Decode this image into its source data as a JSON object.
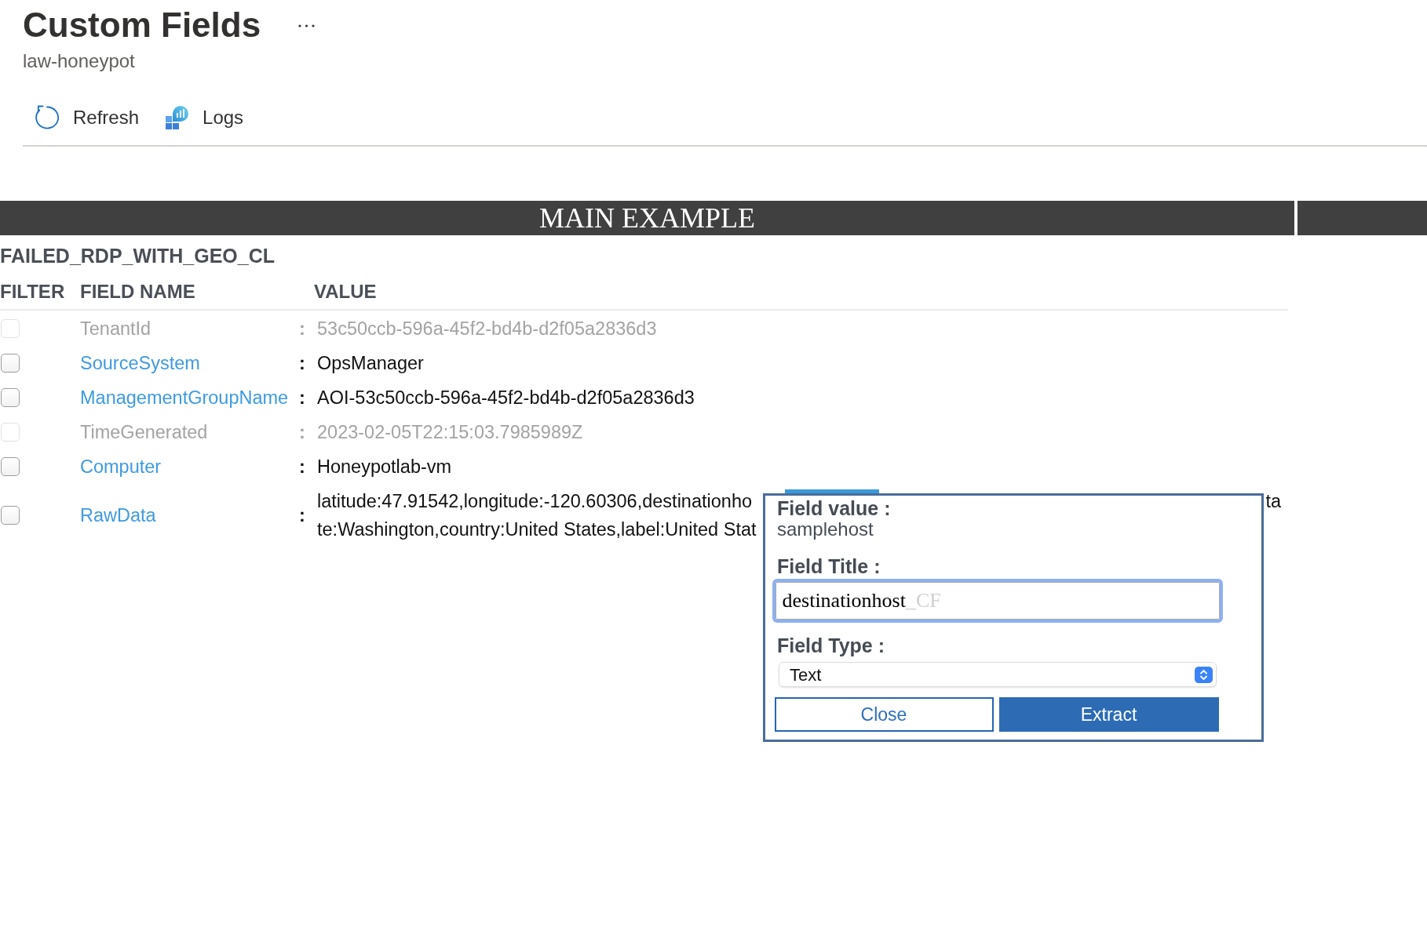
{
  "page": {
    "title": "Custom Fields",
    "subtitle": "law-honeypot"
  },
  "toolbar": [
    {
      "kind": "refresh",
      "label": "Refresh"
    },
    {
      "kind": "logs",
      "label": "Logs"
    }
  ],
  "banner": {
    "title": "MAIN EXAMPLE"
  },
  "table": {
    "name": "FAILED_RDP_WITH_GEO_CL",
    "columns": [
      "FILTER",
      "FIELD NAME",
      "VALUE"
    ],
    "rows": [
      {
        "name": "TenantId",
        "separator": ":",
        "value": "53c50ccb-596a-45f2-bd4b-d2f05a2836d3",
        "disabled": true,
        "checked": false
      },
      {
        "name": "SourceSystem",
        "separator": ":",
        "value": "OpsManager",
        "disabled": false,
        "checked": false
      },
      {
        "name": "ManagementGroupName",
        "separator": ":",
        "value": "AOI-53c50ccb-596a-45f2-bd4b-d2f05a2836d3",
        "disabled": false,
        "checked": false
      },
      {
        "name": "TimeGenerated",
        "separator": ":",
        "value": "2023-02-05T22:15:03.7985989Z",
        "disabled": true,
        "checked": false
      },
      {
        "name": "Computer",
        "separator": ":",
        "value": "Honeypotlab-vm",
        "disabled": false,
        "checked": false
      },
      {
        "name": "RawData",
        "separator": ":",
        "value_lines": [
          {
            "text": "latitude:47.91542,longitude:-120.60306,destinationho",
            "tail": "ta"
          },
          {
            "text": "te:Washington,country:United States,label:United Stat"
          }
        ],
        "disabled": false,
        "checked": false
      }
    ]
  },
  "dialog": {
    "fields": [
      {
        "kind": "readonly",
        "label": "Field value :",
        "value": "samplehost"
      },
      {
        "kind": "input",
        "label": "Field Title :",
        "value": "destinationhost",
        "suffix": "_CF",
        "focused": true
      },
      {
        "kind": "select",
        "label": "Field Type :",
        "value": "Text"
      }
    ],
    "buttons": [
      {
        "kind": "secondary",
        "label": "Close"
      },
      {
        "kind": "primary",
        "label": "Extract"
      }
    ]
  }
}
